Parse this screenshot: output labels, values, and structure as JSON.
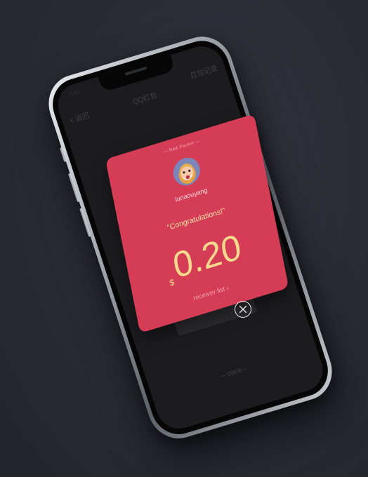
{
  "nav": {
    "back_label": "< 返回",
    "title": "QQ红包",
    "records_label": "红包记录"
  },
  "status": {
    "time": "9:41"
  },
  "background_footer": "— QQ红包 —",
  "packet": {
    "header": "— Red Packet —",
    "avatar": "avatar-old-man-icon",
    "sender": "lunaouyang",
    "greeting": "\"Congratulations!\"",
    "currency": "$",
    "amount": "0.20",
    "receiver_link": "receiver list"
  },
  "close_icon": "close-x-icon",
  "colors": {
    "background": "#2a2c34",
    "packet_red": "#d53d57",
    "gold": "#f6d98c",
    "screen_dark": "#1c1c1e"
  }
}
